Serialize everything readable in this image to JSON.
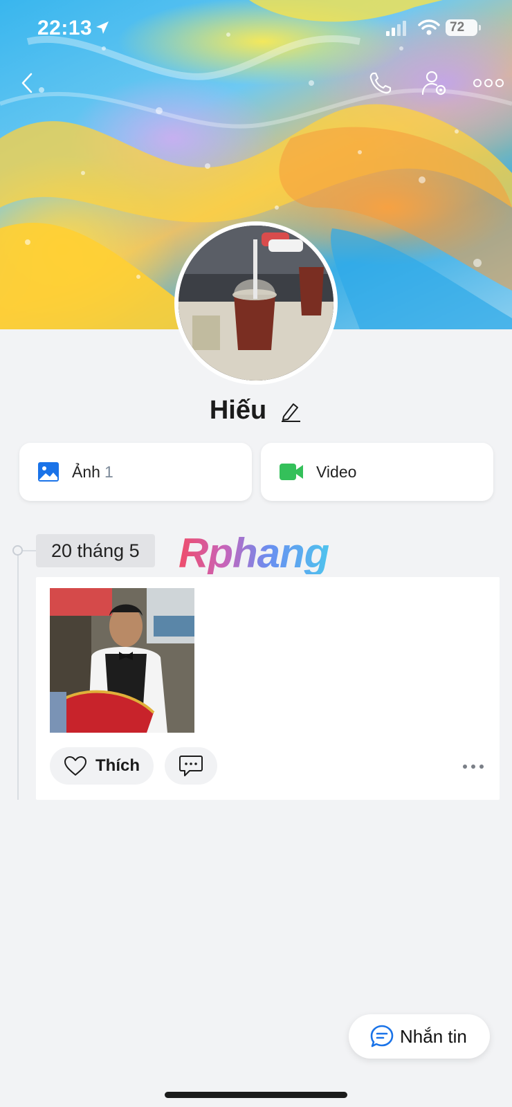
{
  "status_bar": {
    "time": "22:13",
    "battery": "72"
  },
  "colors": {
    "accent_blue": "#1a73e8",
    "video_green": "#34c05a",
    "watermark_gradient": [
      "#ef4d6a",
      "#6a8ef0",
      "#4fc3ee"
    ]
  },
  "profile": {
    "name": "Hiếu"
  },
  "media": {
    "photos": {
      "label": "Ảnh",
      "count": "1",
      "icon": "image-icon"
    },
    "video": {
      "label": "Video",
      "icon": "video-camera-icon"
    }
  },
  "timeline": {
    "date": "20 tháng 5",
    "watermark": "Rphang",
    "post": {
      "like_label": "Thích"
    }
  },
  "message_button": {
    "label": "Nhắn tin"
  },
  "icons": [
    "back-icon",
    "phone-icon",
    "user-settings-icon",
    "more-icon",
    "edit-icon",
    "heart-icon",
    "comment-icon"
  ]
}
